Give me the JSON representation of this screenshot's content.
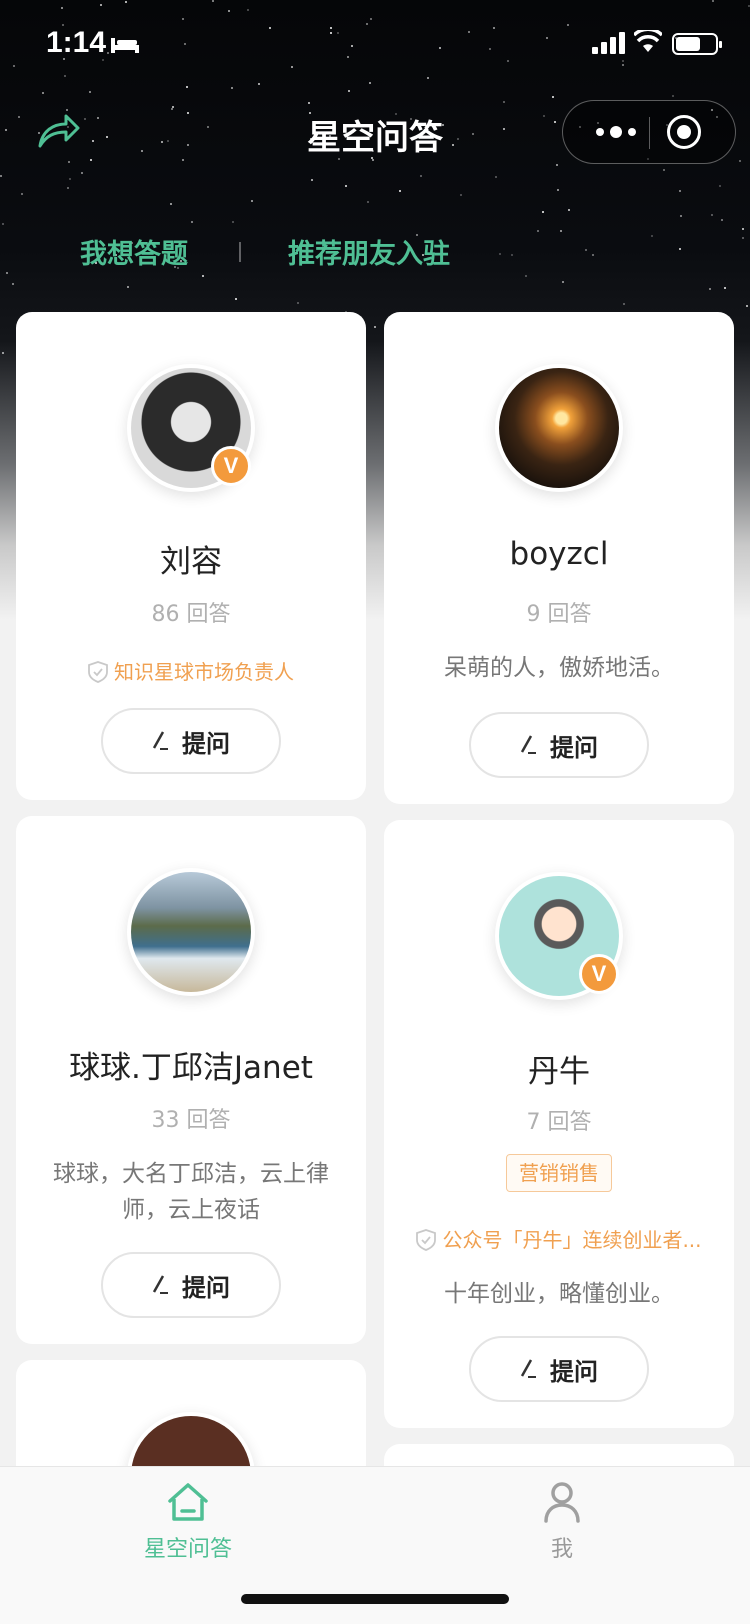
{
  "status_bar": {
    "time": "1:14"
  },
  "nav": {
    "title": "星空问答"
  },
  "links": {
    "answer": "我想答题",
    "recommend": "推荐朋友入驻"
  },
  "cards": [
    {
      "name": "刘容",
      "count": "86 回答",
      "cert": "知识星球市场负责人",
      "ask": "提问"
    },
    {
      "name": "boyzcl",
      "count": "9 回答",
      "desc": "呆萌的人，傲娇地活。",
      "ask": "提问"
    },
    {
      "name": "球球.丁邱洁Janet",
      "count": "33 回答",
      "desc": "球球，大名丁邱洁，云上律师，云上夜话",
      "ask": "提问"
    },
    {
      "name": "丹牛",
      "count": "7 回答",
      "tag": "营销销售",
      "cert": "公众号「丹牛」连续创业者...",
      "desc": "十年创业，略懂创业。",
      "ask": "提问"
    }
  ],
  "tabbar": {
    "home": "星空问答",
    "me": "我"
  },
  "colors": {
    "accent": "#4fbf94",
    "vip": "#f39a3c",
    "cert": "#f0a050"
  },
  "icons": [
    "share-icon",
    "more-icon",
    "close-capsule-icon",
    "shield-icon",
    "pen-icon",
    "home-icon",
    "user-icon"
  ]
}
